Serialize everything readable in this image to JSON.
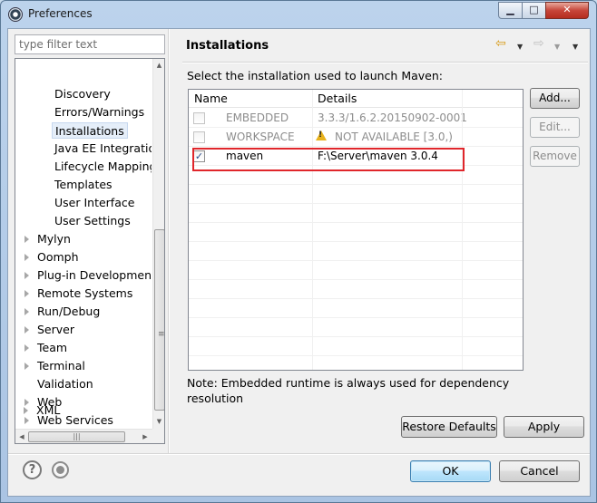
{
  "window": {
    "title": "Preferences"
  },
  "filter": {
    "placeholder": "type filter text"
  },
  "tree": {
    "children": [
      "Discovery",
      "Errors/Warnings",
      "Installations",
      "Java EE Integration",
      "Lifecycle Mapping",
      "Templates",
      "User Interface",
      "User Settings"
    ],
    "selected": "Installations",
    "roots": [
      {
        "label": "Mylyn",
        "expandable": true
      },
      {
        "label": "Oomph",
        "expandable": true
      },
      {
        "label": "Plug-in Development",
        "expandable": true
      },
      {
        "label": "Remote Systems",
        "expandable": true
      },
      {
        "label": "Run/Debug",
        "expandable": true
      },
      {
        "label": "Server",
        "expandable": true
      },
      {
        "label": "Team",
        "expandable": true
      },
      {
        "label": "Terminal",
        "expandable": true
      },
      {
        "label": "Validation",
        "expandable": false
      },
      {
        "label": "Web",
        "expandable": true
      },
      {
        "label": "Web Services",
        "expandable": true
      },
      {
        "label": "XML",
        "expandable": true
      }
    ]
  },
  "page": {
    "title": "Installations",
    "instruction": "Select the installation used to launch Maven:",
    "columns": [
      "Name",
      "Details"
    ],
    "rows": [
      {
        "name": "EMBEDDED",
        "details": "3.3.3/1.6.2.20150902-0001",
        "checked": false,
        "enabled": false
      },
      {
        "name": "WORKSPACE",
        "details": "NOT AVAILABLE [3.0,)",
        "checked": false,
        "enabled": false,
        "warning": true
      },
      {
        "name": "maven",
        "details": "F:\\Server\\maven 3.0.4",
        "checked": true,
        "enabled": true
      }
    ],
    "note": "Note: Embedded runtime is always used for dependency resolution",
    "side_buttons": {
      "add": "Add...",
      "edit": "Edit...",
      "remove": "Remove"
    },
    "restore_defaults": "Restore Defaults",
    "apply": "Apply"
  },
  "footer": {
    "ok": "OK",
    "cancel": "Cancel"
  },
  "colors": {
    "highlight": "#e0262b",
    "nav_back": "#d79a16"
  }
}
